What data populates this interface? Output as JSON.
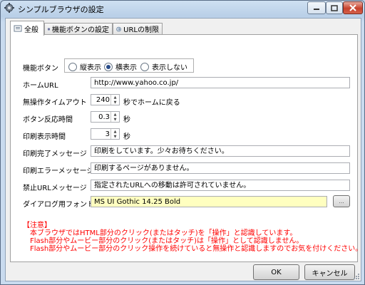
{
  "window": {
    "title": "シンプルブラウザの設定"
  },
  "tabs": [
    {
      "label": "全般",
      "active": true,
      "icon": "general-settings-icon"
    },
    {
      "label": "機能ボタンの設定",
      "active": false,
      "icon": "function-button-icon"
    },
    {
      "label": "URLの制限",
      "active": false,
      "icon": "url-restriction-icon"
    }
  ],
  "general": {
    "function_button": {
      "label": "機能ボタン",
      "options": [
        "縦表示",
        "横表示",
        "表示しない"
      ],
      "selected": "横表示"
    },
    "home_url": {
      "label": "ホームURL",
      "value": "http://www.yahoo.co.jp/"
    },
    "idle_timeout": {
      "label": "無操作タイムアウト",
      "value": "240",
      "suffix": "秒でホームに戻る"
    },
    "button_response": {
      "label": "ボタン反応時間",
      "value": "0.3",
      "suffix": "秒"
    },
    "print_display": {
      "label": "印刷表示時間",
      "value": "3",
      "suffix": "秒"
    },
    "print_done_message": {
      "label": "印刷完了メッセージ",
      "value": "印刷をしています。少々お待ちください。"
    },
    "print_error_message": {
      "label": "印刷エラーメッセージ",
      "value": "印刷するページがありません。"
    },
    "forbidden_url_message": {
      "label": "禁止URLメッセージ",
      "value": "指定されたURLへの移動は許可されていません。"
    },
    "dialog_font": {
      "label": "ダイアログ用フォント",
      "value": "MS UI Gothic 14.25 Bold",
      "button_label": "..."
    }
  },
  "notes": {
    "heading": "【注意】",
    "lines": [
      "本ブラウザではHTML部分のクリック(またはタッチ)を「操作」と認識しています。",
      "Flash部分やムービー部分のクリック(またはタッチ)は「操作」として認識しません。",
      "Flash部分やムービー部分のクリック操作を続けていると無操作と認識しますのでお気を付けください。"
    ]
  },
  "buttons": {
    "ok": "OK",
    "cancel": "キャンセル"
  },
  "colors": {
    "notes": "#ff0000",
    "font_field_bg": "#ffffc0",
    "title_bar": "#c3d6ec"
  }
}
